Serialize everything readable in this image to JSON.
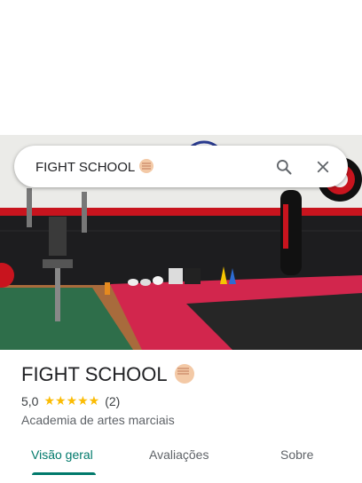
{
  "search": {
    "query": "FIGHT SCHOOL"
  },
  "icons": {
    "search": "search-icon",
    "close": "close-icon",
    "emoji": "fist-emoji"
  },
  "place": {
    "name": "FIGHT SCHOOL",
    "rating": "5,0",
    "stars": "★★★★★",
    "review_count": "(2)",
    "category": "Academia de artes marciais"
  },
  "tabs": [
    {
      "label": "Visão geral",
      "active": true
    },
    {
      "label": "Avaliações",
      "active": false
    },
    {
      "label": "Sobre",
      "active": false
    }
  ],
  "colors": {
    "accent": "#00796b",
    "stars": "#fbbc04"
  }
}
